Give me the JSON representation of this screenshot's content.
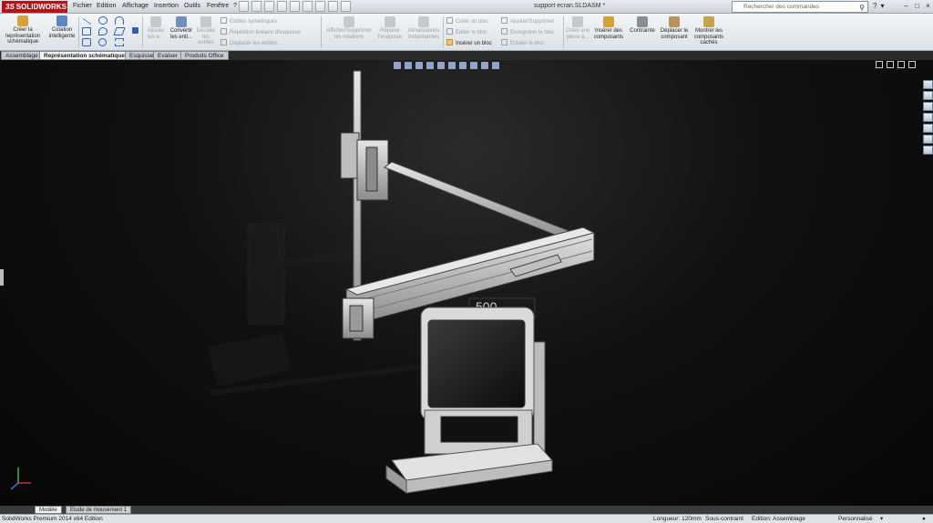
{
  "app": {
    "brand_ds": "3S",
    "brand": "SOLIDWORKS",
    "doc_title": "support ecran.SLDASM *"
  },
  "menus": [
    "Fichier",
    "Edition",
    "Affichage",
    "Insertion",
    "Outils",
    "Fenêtre",
    "?"
  ],
  "search": {
    "placeholder": "Rechercher des commandes"
  },
  "ribbon": {
    "creer_rep": "Créer la représentation schématique",
    "cotation": "Cotation intelligente",
    "ajuster": "Ajuster les e...",
    "convertir": "Convertir les enti...",
    "decaler": "Décaler les entités",
    "entites_sym": "Entités symétriques",
    "repetition": "Répétition linéaire d'esquisse",
    "deplacer_ent": "Déplacer les entités",
    "afficher_rel": "Afficher/Supprimer les relations",
    "reparer": "Réparer l'esquisse",
    "aimantations": "Aimantations instantanées",
    "creer_bloc": "Créer un bloc",
    "editer_bloc": "Editer le bloc",
    "inserer_bloc": "Insérer un bloc",
    "ajouter_sup": "Ajouter/Supprimer",
    "enregistrer_bloc": "Enregistrer le bloc",
    "eclater_bloc": "Eclater le bloc",
    "creer_piece": "Créer une pièce à...",
    "inserer_comp": "Insérer des composants",
    "contrainte": "Contrainte",
    "deplacer_comp": "Déplacer le composant",
    "montrer_caches": "Montrer les composants cachés"
  },
  "tabs": [
    "Assemblage",
    "Représentation schématique",
    "Esquisse",
    "Evaluer",
    "Produits Office"
  ],
  "viewport": {
    "label_500": "500"
  },
  "bottom_tabs": [
    "Modèle",
    "Etude de mouvement 1"
  ],
  "status": {
    "edition": "SolidWorks Premium 2014 x64 Edition",
    "longueur": "Longueur: 120mm",
    "contraint": "Sous-contraint",
    "edition_mode": "Edition: Assemblage",
    "perso": "Personnalisé"
  },
  "colors": {
    "brand_red": "#b0151a",
    "viewport_bg": "#111111",
    "metal": "#c9c9c9"
  }
}
